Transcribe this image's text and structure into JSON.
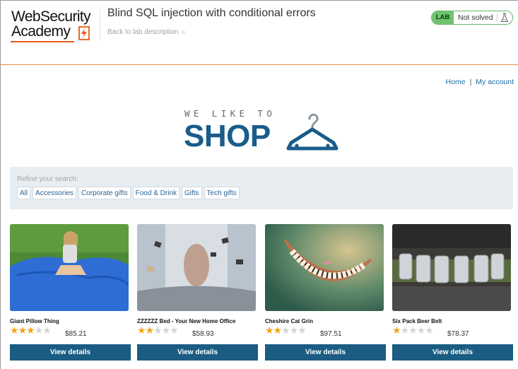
{
  "header": {
    "logo_line1": "WebSecurity",
    "logo_line2": "Academy",
    "lab_title": "Blind SQL injection with conditional errors",
    "back_link": "Back to lab description",
    "back_chevron": "»",
    "badge": "LAB",
    "status": "Not solved",
    "colors": {
      "accent": "#e8591a",
      "badge_green": "#70c36f",
      "brand_blue": "#1a5c8a"
    }
  },
  "nav": {
    "home": "Home",
    "separator": "|",
    "account": "My account"
  },
  "banner": {
    "tagline": "WE LIKE TO",
    "word": "SHOP",
    "icon": "hanger-icon"
  },
  "search": {
    "label": "Refine your search:",
    "filters": [
      "All",
      "Accessories",
      "Corporate gifts",
      "Food & Drink",
      "Gifts",
      "Tech gifts"
    ]
  },
  "products": [
    {
      "name": "Giant Pillow Thing",
      "rating": 3,
      "max_rating": 5,
      "price": "$85.21",
      "button": "View details"
    },
    {
      "name": "ZZZZZZ Bed - Your New Home Office",
      "rating": 2,
      "max_rating": 5,
      "price": "$58.93",
      "button": "View details"
    },
    {
      "name": "Cheshire Cat Grin",
      "rating": 2,
      "max_rating": 5,
      "price": "$97.51",
      "button": "View details"
    },
    {
      "name": "Six Pack Beer Belt",
      "rating": 1,
      "max_rating": 5,
      "price": "$78.37",
      "button": "View details"
    }
  ]
}
